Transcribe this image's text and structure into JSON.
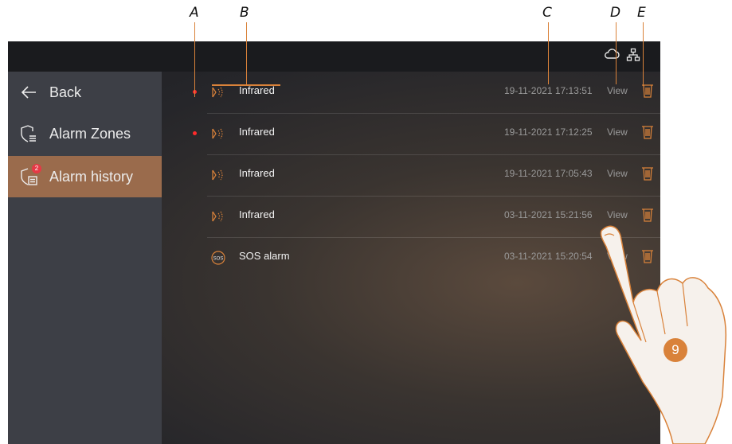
{
  "callouts": {
    "a": "A",
    "b": "B",
    "c": "C",
    "d": "D",
    "e": "E"
  },
  "step_number": "9",
  "colors": {
    "accent": "#d9823a",
    "active_item": "#9a6b4c",
    "unread_dot": "#ff2b2b",
    "sidebar": "#3d3f46"
  },
  "status_icons": [
    "cloud-icon",
    "network-icon"
  ],
  "sidebar": {
    "back_label": "Back",
    "items": [
      {
        "label": "Alarm Zones",
        "icon": "shield-list-icon"
      },
      {
        "label": "Alarm history",
        "icon": "shield-history-icon",
        "badge": "2"
      }
    ]
  },
  "alarms": [
    {
      "type": "Infrared",
      "icon": "infrared-icon",
      "timestamp": "19-11-2021 17:13:51",
      "view": "View",
      "unread": true
    },
    {
      "type": "Infrared",
      "icon": "infrared-icon",
      "timestamp": "19-11-2021 17:12:25",
      "view": "View",
      "unread": true
    },
    {
      "type": "Infrared",
      "icon": "infrared-icon",
      "timestamp": "19-11-2021 17:05:43",
      "view": "View",
      "unread": false
    },
    {
      "type": "Infrared",
      "icon": "infrared-icon",
      "timestamp": "03-11-2021 15:21:56",
      "view": "View",
      "unread": false
    },
    {
      "type": "SOS alarm",
      "icon": "sos-icon",
      "timestamp": "03-11-2021 15:20:54",
      "view": "View",
      "unread": false
    }
  ]
}
